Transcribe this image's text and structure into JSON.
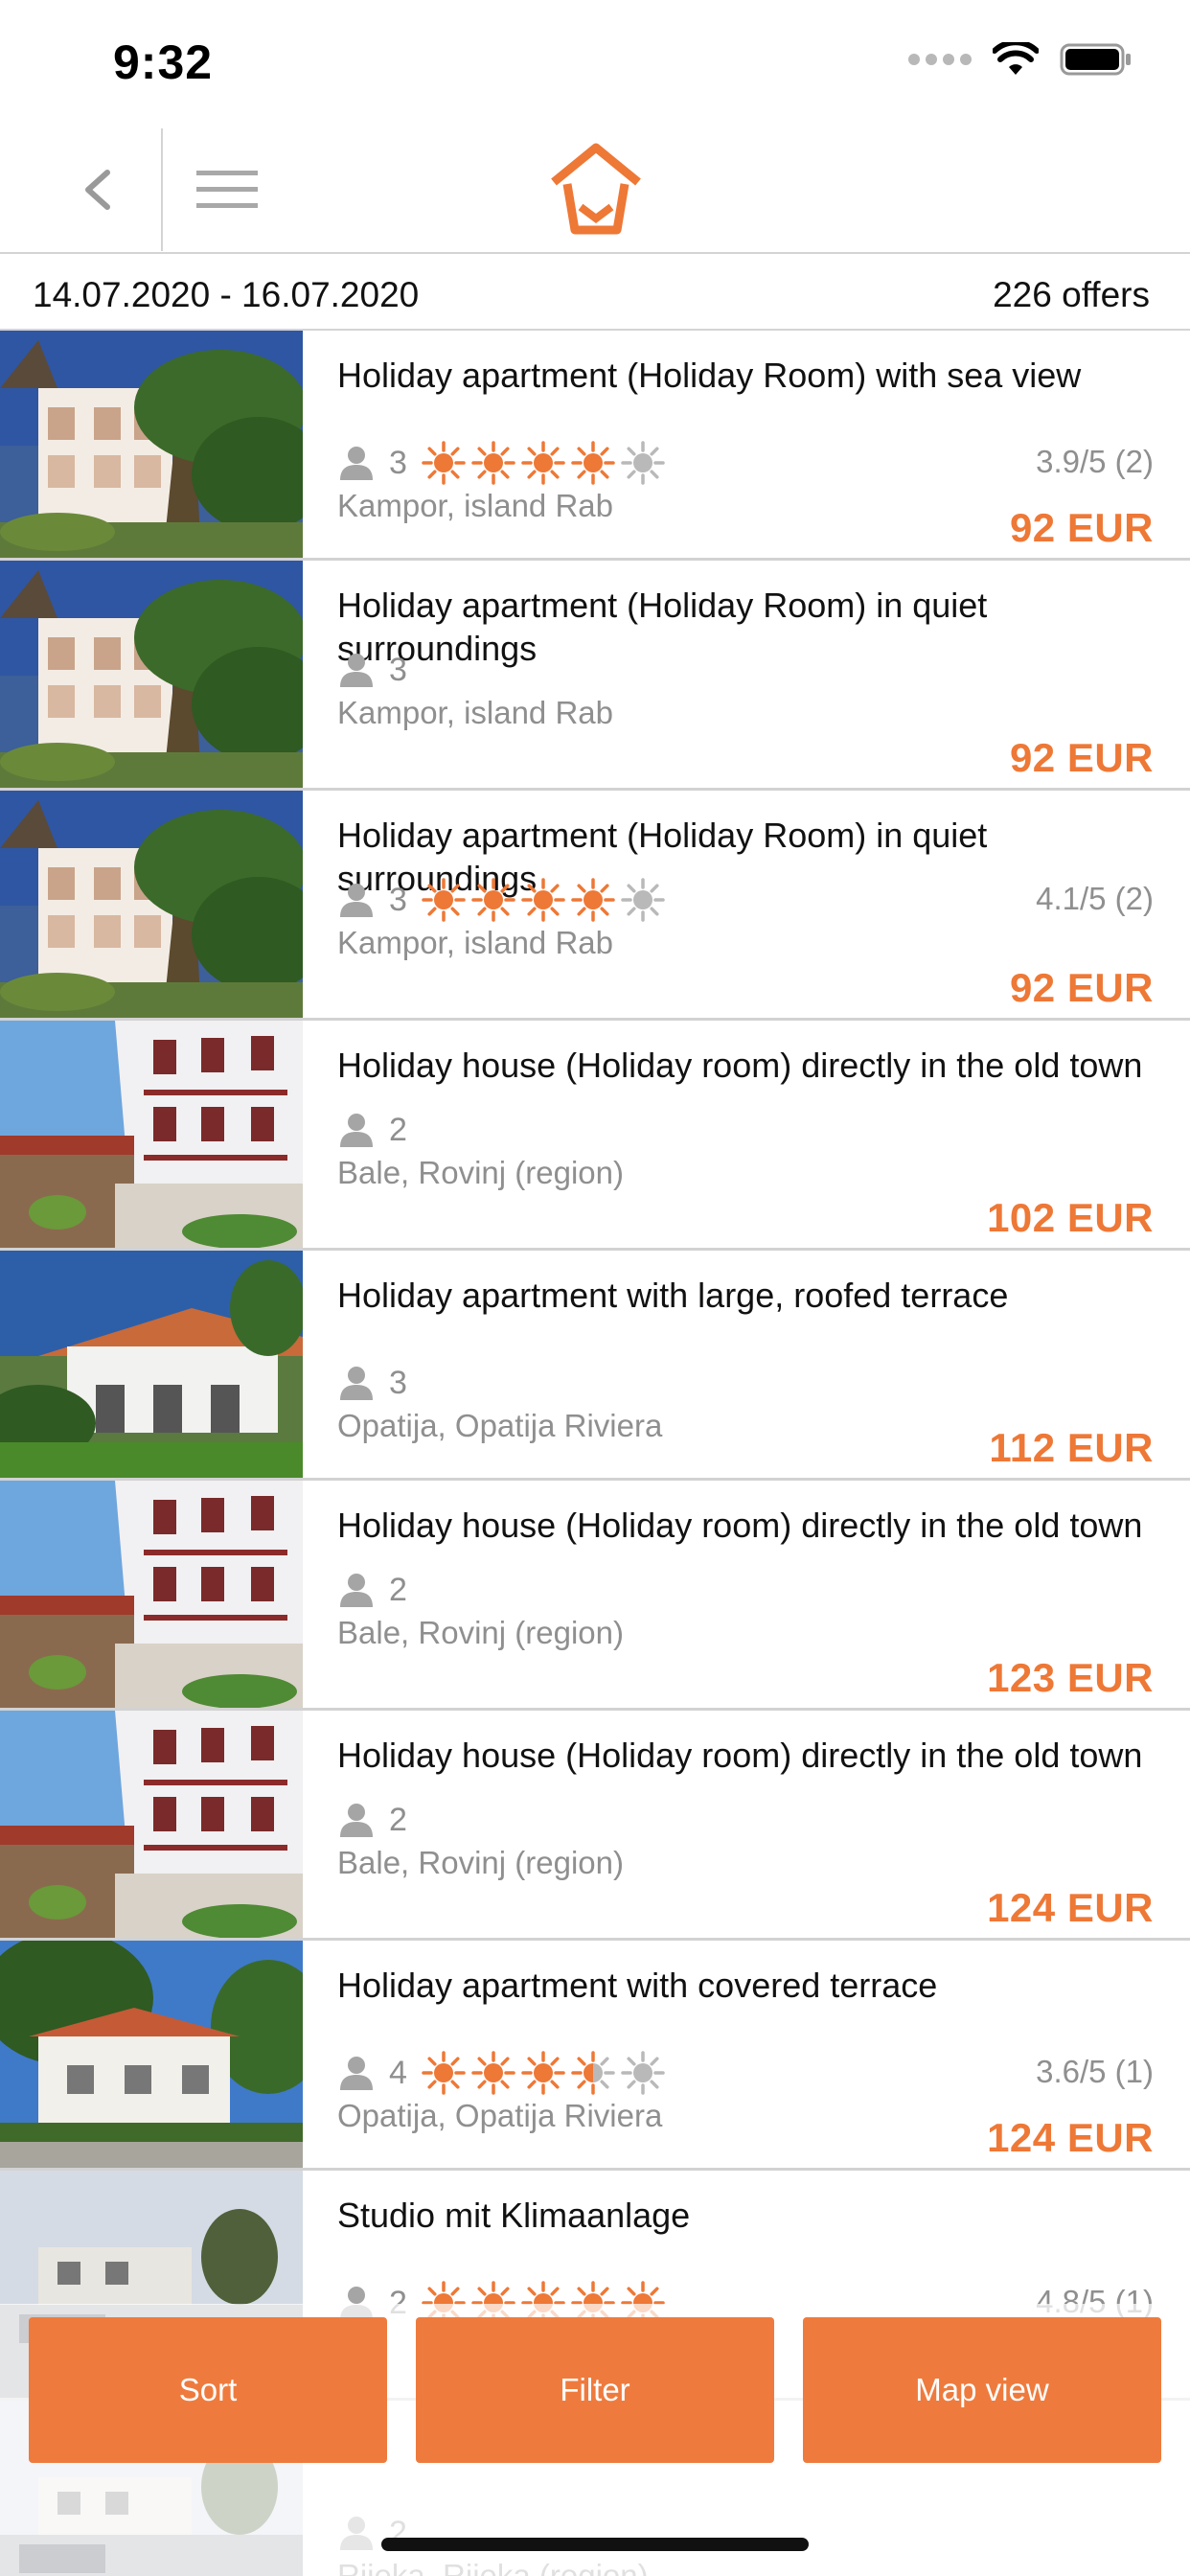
{
  "status_bar": {
    "time": "9:32"
  },
  "header": {
    "back_icon": "chevron-left-icon",
    "menu_icon": "hamburger-menu-icon",
    "logo_icon": "house-logo-icon",
    "accent_color": "#ee7836"
  },
  "search_info": {
    "date_range": "14.07.2020 - 16.07.2020",
    "offers_count": "226 offers"
  },
  "listings": [
    {
      "title": "Holiday apartment (Holiday Room) with sea view",
      "guests": "3",
      "rating_stars": 3.9,
      "rating": "3.9/5 (2)",
      "location": "Kampor, island Rab",
      "price": "92 EUR",
      "photo": "villa-palm"
    },
    {
      "title": "Holiday apartment (Holiday Room) in quiet surroundings",
      "guests": "3",
      "rating_stars": null,
      "rating": "",
      "location": "Kampor, island Rab",
      "price": "92 EUR",
      "photo": "villa-palm"
    },
    {
      "title": "Holiday apartment (Holiday Room) in quiet surroundings",
      "guests": "3",
      "rating_stars": 4.1,
      "rating": "4.1/5 (2)",
      "location": "Kampor, island Rab",
      "price": "92 EUR",
      "photo": "villa-palm"
    },
    {
      "title": "Holiday house (Holiday room) directly in the old town",
      "guests": "2",
      "rating_stars": null,
      "rating": "",
      "location": "Bale, Rovinj (region)",
      "price": "102 EUR",
      "photo": "old-town"
    },
    {
      "title": "Holiday apartment with large, roofed terrace",
      "guests": "3",
      "rating_stars": null,
      "rating": "",
      "location": "Opatija, Opatija Riviera",
      "price": "112 EUR",
      "photo": "terrace"
    },
    {
      "title": "Holiday house (Holiday room) directly in the old town",
      "guests": "2",
      "rating_stars": null,
      "rating": "",
      "location": "Bale, Rovinj (region)",
      "price": "123 EUR",
      "photo": "old-town"
    },
    {
      "title": "Holiday house (Holiday room) directly in the old town",
      "guests": "2",
      "rating_stars": null,
      "rating": "",
      "location": "Bale, Rovinj (region)",
      "price": "124 EUR",
      "photo": "old-town"
    },
    {
      "title": "Holiday apartment with covered terrace",
      "guests": "4",
      "rating_stars": 3.6,
      "rating": "3.6/5 (1)",
      "location": "Opatija, Opatija Riviera",
      "price": "124 EUR",
      "photo": "covered-terrace"
    },
    {
      "title": "Studio mit Klimaanlage",
      "guests": "2",
      "rating_stars": 4.8,
      "rating": "4.8/5 (1)",
      "location": "",
      "price": "",
      "photo": "studio"
    },
    {
      "title": "",
      "guests": "2",
      "rating_stars": null,
      "rating": "",
      "location": "Rijeka, Rijeka (region)",
      "price": "",
      "photo": "studio"
    }
  ],
  "actions": {
    "sort_label": "Sort",
    "filter_label": "Filter",
    "map_label": "Map view",
    "button_color": "#ee7b3d"
  }
}
